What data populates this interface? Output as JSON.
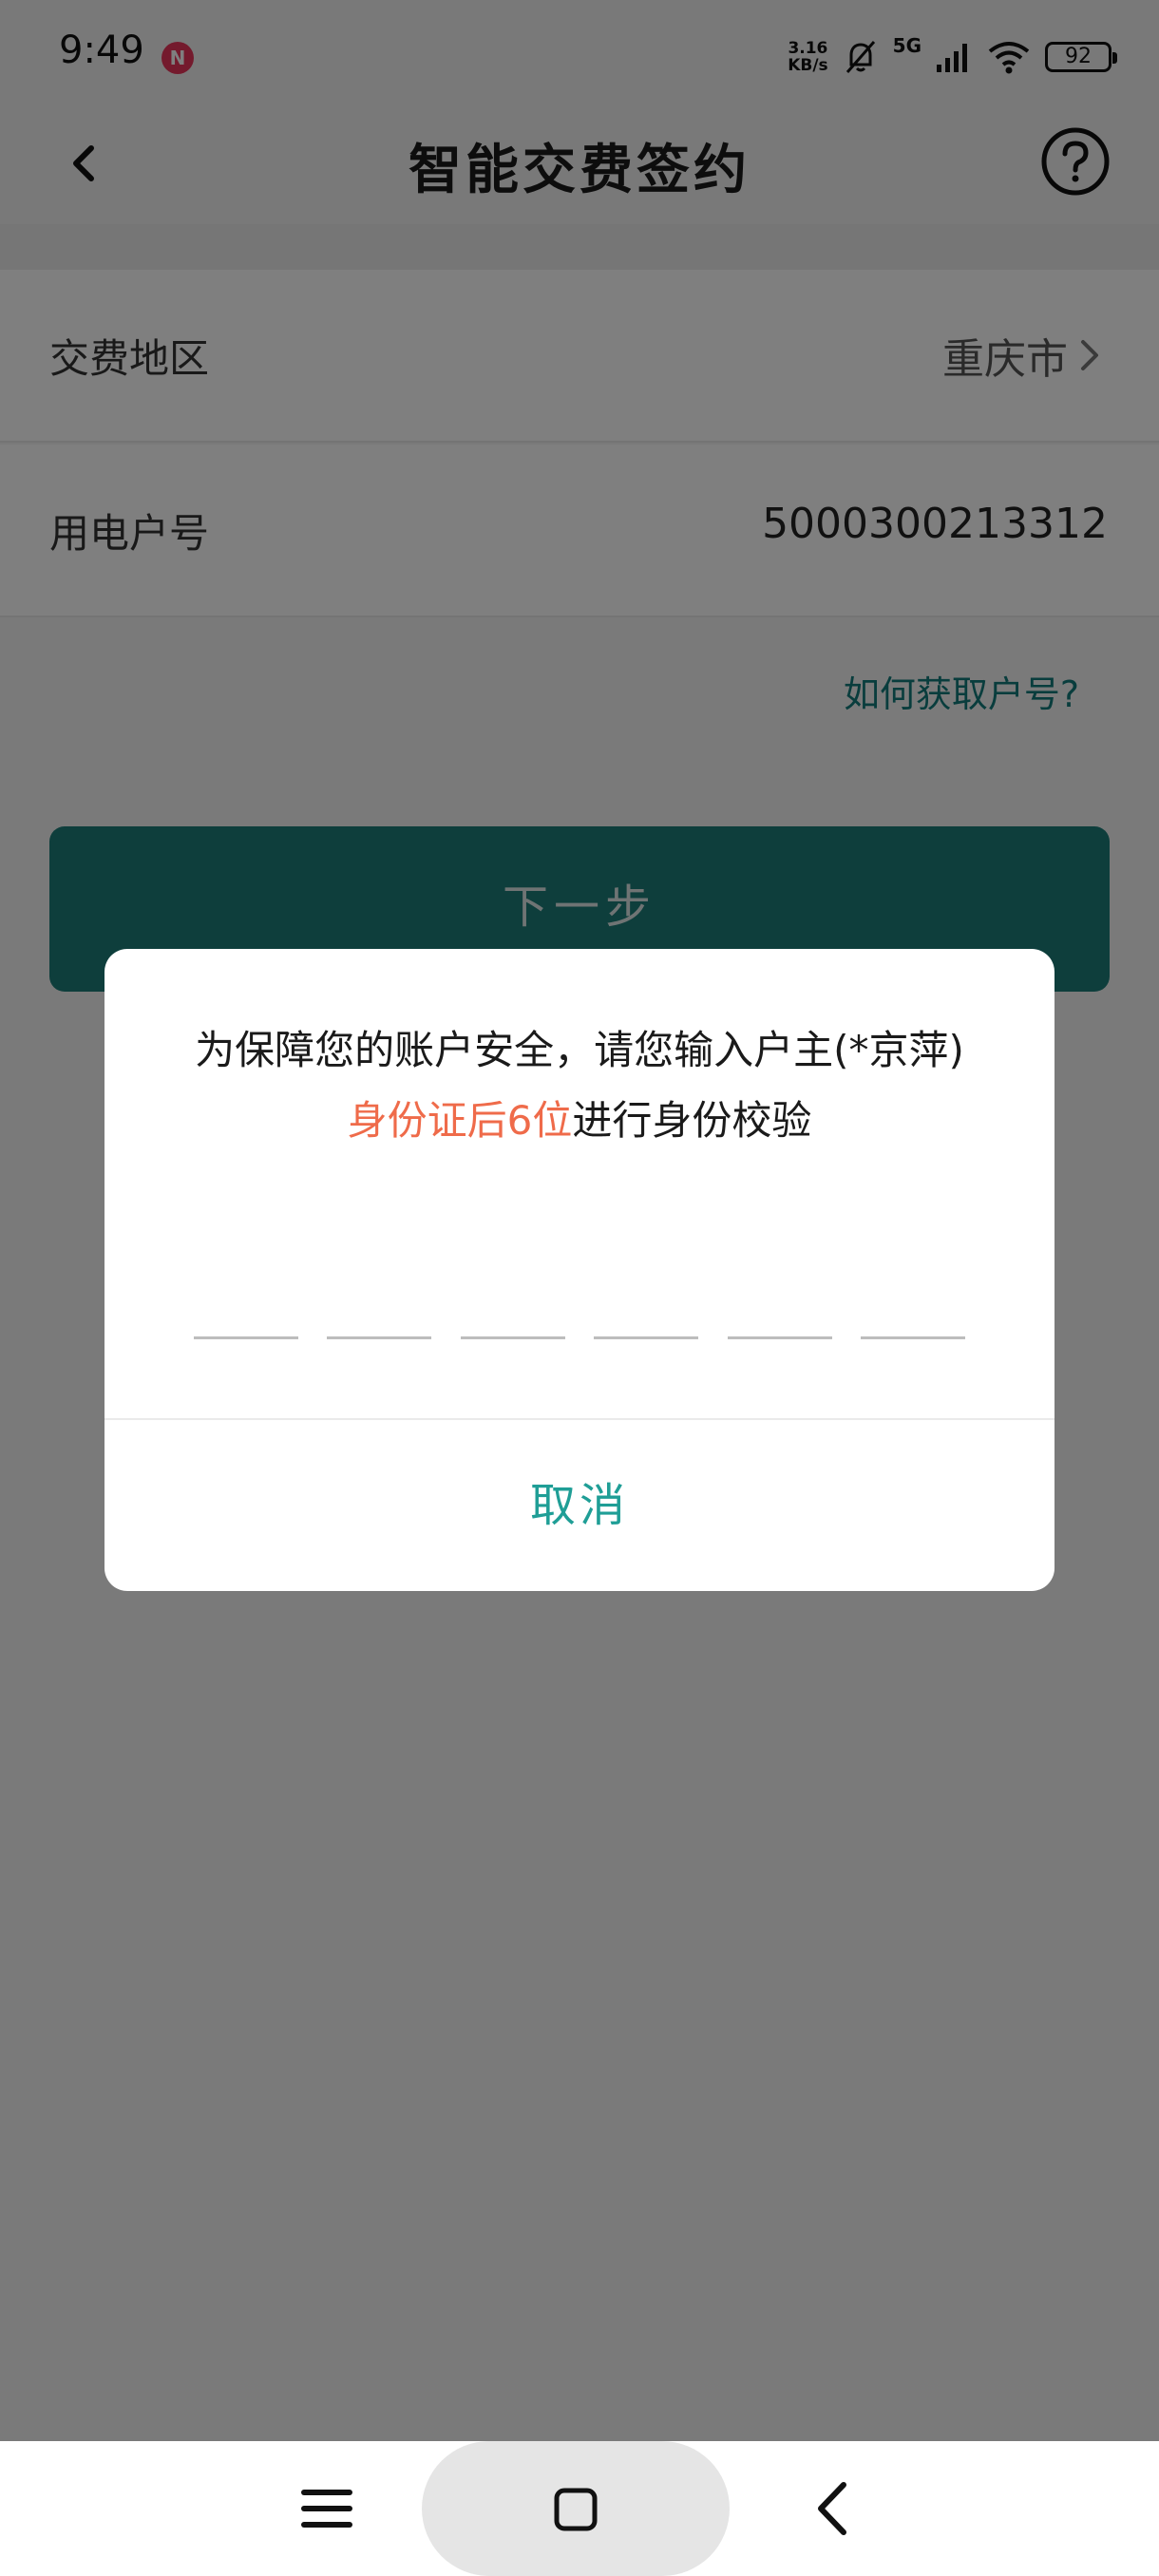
{
  "status_bar": {
    "time": "9:49",
    "notif_badge": "N",
    "net_speed_top": "3.16",
    "net_speed_bottom": "KB/s",
    "network_type": "5G",
    "battery_level": "92"
  },
  "header": {
    "title": "智能交费签约"
  },
  "form": {
    "region_label": "交费地区",
    "region_value": "重庆市",
    "account_label": "用电户号",
    "account_value": "5000300213312",
    "help_link": "如何获取户号?",
    "next_button": "下一步"
  },
  "dialog": {
    "message_part1": "为保障您的账户安全，请您输入户主(*京萍)",
    "message_highlight": "身份证后6位",
    "message_part2": "进行身份校验",
    "code_slots": 6,
    "cancel_button": "取消"
  },
  "colors": {
    "accent_teal": "#1d7d78",
    "link_teal": "#137a7a",
    "highlight_orange": "#ef6b4a",
    "cancel_teal": "#1f9e96"
  }
}
